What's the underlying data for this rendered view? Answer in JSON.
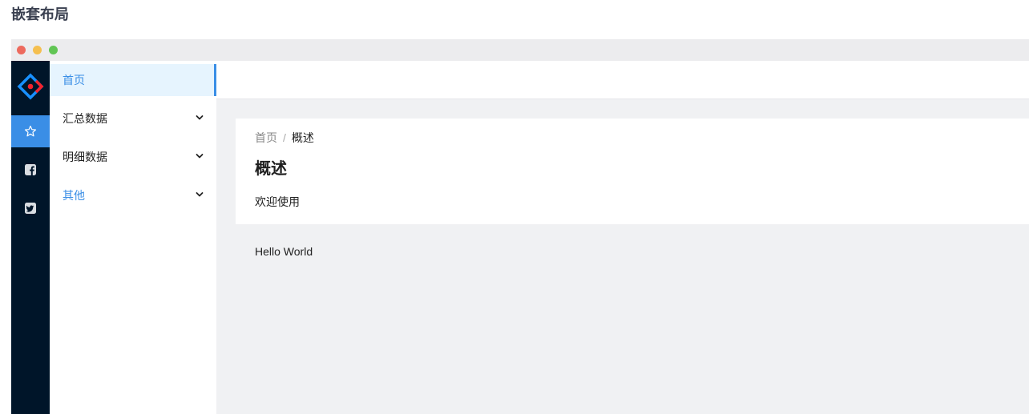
{
  "page": {
    "heading": "嵌套布局"
  },
  "sidebar": {
    "rail_icons": [
      "logo-icon",
      "star-icon",
      "facebook-icon",
      "twitter-icon"
    ],
    "items": [
      {
        "label": "首页",
        "active": true,
        "expandable": false
      },
      {
        "label": "汇总数据",
        "active": false,
        "expandable": true
      },
      {
        "label": "明细数据",
        "active": false,
        "expandable": true
      },
      {
        "label": "其他",
        "active": false,
        "expandable": true
      }
    ]
  },
  "main": {
    "breadcrumb": [
      "首页",
      "概述"
    ],
    "title": "概述",
    "description": "欢迎使用",
    "content": "Hello World"
  },
  "colors": {
    "accent": "#3a8ee6",
    "rail_bg": "#001529",
    "active_item_bg": "#e6f4fe",
    "content_bg": "#f0f1f3"
  }
}
